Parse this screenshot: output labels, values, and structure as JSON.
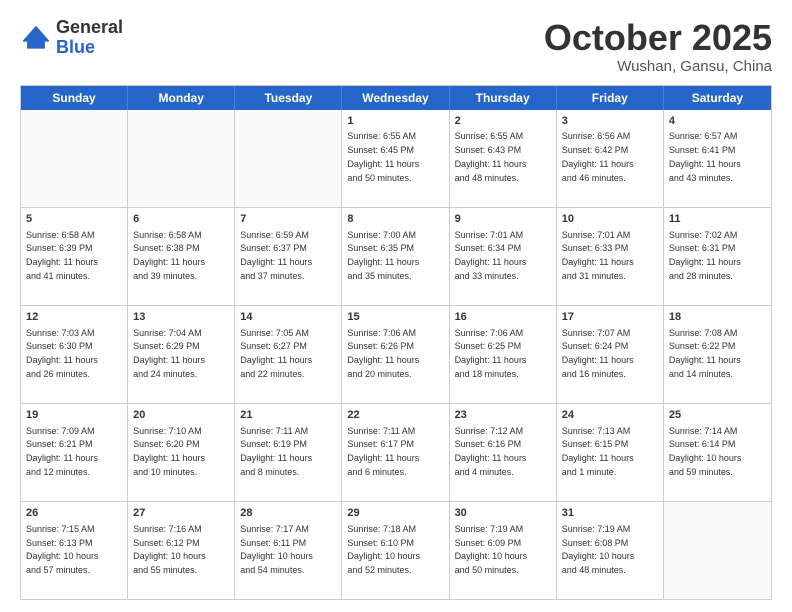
{
  "logo": {
    "general": "General",
    "blue": "Blue"
  },
  "title": {
    "month": "October 2025",
    "location": "Wushan, Gansu, China"
  },
  "days": [
    "Sunday",
    "Monday",
    "Tuesday",
    "Wednesday",
    "Thursday",
    "Friday",
    "Saturday"
  ],
  "weeks": [
    [
      {
        "day": "",
        "content": ""
      },
      {
        "day": "",
        "content": ""
      },
      {
        "day": "",
        "content": ""
      },
      {
        "day": "1",
        "content": "Sunrise: 6:55 AM\nSunset: 6:45 PM\nDaylight: 11 hours\nand 50 minutes."
      },
      {
        "day": "2",
        "content": "Sunrise: 6:55 AM\nSunset: 6:43 PM\nDaylight: 11 hours\nand 48 minutes."
      },
      {
        "day": "3",
        "content": "Sunrise: 6:56 AM\nSunset: 6:42 PM\nDaylight: 11 hours\nand 46 minutes."
      },
      {
        "day": "4",
        "content": "Sunrise: 6:57 AM\nSunset: 6:41 PM\nDaylight: 11 hours\nand 43 minutes."
      }
    ],
    [
      {
        "day": "5",
        "content": "Sunrise: 6:58 AM\nSunset: 6:39 PM\nDaylight: 11 hours\nand 41 minutes."
      },
      {
        "day": "6",
        "content": "Sunrise: 6:58 AM\nSunset: 6:38 PM\nDaylight: 11 hours\nand 39 minutes."
      },
      {
        "day": "7",
        "content": "Sunrise: 6:59 AM\nSunset: 6:37 PM\nDaylight: 11 hours\nand 37 minutes."
      },
      {
        "day": "8",
        "content": "Sunrise: 7:00 AM\nSunset: 6:35 PM\nDaylight: 11 hours\nand 35 minutes."
      },
      {
        "day": "9",
        "content": "Sunrise: 7:01 AM\nSunset: 6:34 PM\nDaylight: 11 hours\nand 33 minutes."
      },
      {
        "day": "10",
        "content": "Sunrise: 7:01 AM\nSunset: 6:33 PM\nDaylight: 11 hours\nand 31 minutes."
      },
      {
        "day": "11",
        "content": "Sunrise: 7:02 AM\nSunset: 6:31 PM\nDaylight: 11 hours\nand 28 minutes."
      }
    ],
    [
      {
        "day": "12",
        "content": "Sunrise: 7:03 AM\nSunset: 6:30 PM\nDaylight: 11 hours\nand 26 minutes."
      },
      {
        "day": "13",
        "content": "Sunrise: 7:04 AM\nSunset: 6:29 PM\nDaylight: 11 hours\nand 24 minutes."
      },
      {
        "day": "14",
        "content": "Sunrise: 7:05 AM\nSunset: 6:27 PM\nDaylight: 11 hours\nand 22 minutes."
      },
      {
        "day": "15",
        "content": "Sunrise: 7:06 AM\nSunset: 6:26 PM\nDaylight: 11 hours\nand 20 minutes."
      },
      {
        "day": "16",
        "content": "Sunrise: 7:06 AM\nSunset: 6:25 PM\nDaylight: 11 hours\nand 18 minutes."
      },
      {
        "day": "17",
        "content": "Sunrise: 7:07 AM\nSunset: 6:24 PM\nDaylight: 11 hours\nand 16 minutes."
      },
      {
        "day": "18",
        "content": "Sunrise: 7:08 AM\nSunset: 6:22 PM\nDaylight: 11 hours\nand 14 minutes."
      }
    ],
    [
      {
        "day": "19",
        "content": "Sunrise: 7:09 AM\nSunset: 6:21 PM\nDaylight: 11 hours\nand 12 minutes."
      },
      {
        "day": "20",
        "content": "Sunrise: 7:10 AM\nSunset: 6:20 PM\nDaylight: 11 hours\nand 10 minutes."
      },
      {
        "day": "21",
        "content": "Sunrise: 7:11 AM\nSunset: 6:19 PM\nDaylight: 11 hours\nand 8 minutes."
      },
      {
        "day": "22",
        "content": "Sunrise: 7:11 AM\nSunset: 6:17 PM\nDaylight: 11 hours\nand 6 minutes."
      },
      {
        "day": "23",
        "content": "Sunrise: 7:12 AM\nSunset: 6:16 PM\nDaylight: 11 hours\nand 4 minutes."
      },
      {
        "day": "24",
        "content": "Sunrise: 7:13 AM\nSunset: 6:15 PM\nDaylight: 11 hours\nand 1 minute."
      },
      {
        "day": "25",
        "content": "Sunrise: 7:14 AM\nSunset: 6:14 PM\nDaylight: 10 hours\nand 59 minutes."
      }
    ],
    [
      {
        "day": "26",
        "content": "Sunrise: 7:15 AM\nSunset: 6:13 PM\nDaylight: 10 hours\nand 57 minutes."
      },
      {
        "day": "27",
        "content": "Sunrise: 7:16 AM\nSunset: 6:12 PM\nDaylight: 10 hours\nand 55 minutes."
      },
      {
        "day": "28",
        "content": "Sunrise: 7:17 AM\nSunset: 6:11 PM\nDaylight: 10 hours\nand 54 minutes."
      },
      {
        "day": "29",
        "content": "Sunrise: 7:18 AM\nSunset: 6:10 PM\nDaylight: 10 hours\nand 52 minutes."
      },
      {
        "day": "30",
        "content": "Sunrise: 7:19 AM\nSunset: 6:09 PM\nDaylight: 10 hours\nand 50 minutes."
      },
      {
        "day": "31",
        "content": "Sunrise: 7:19 AM\nSunset: 6:08 PM\nDaylight: 10 hours\nand 48 minutes."
      },
      {
        "day": "",
        "content": ""
      }
    ]
  ]
}
